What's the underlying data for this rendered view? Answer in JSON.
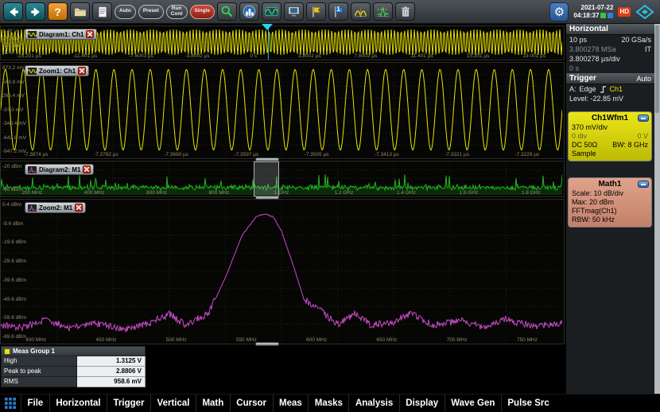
{
  "toolbar": {
    "help_glyph": "?",
    "auto_label": "Auto",
    "preset_label": "Preset",
    "run_label_1": "Run",
    "run_label_2": "Cont",
    "single_label": "Single",
    "marker_glyph": "1",
    "datetime": {
      "date": "2021-07-22",
      "time": "04:18:37"
    },
    "hd_badge": "HD"
  },
  "icons": {
    "gear": "⚙"
  },
  "chart_data": [
    {
      "id": "diagram1",
      "type": "line",
      "title": "Diagram1: Ch1",
      "signal": "sine",
      "cycles": 170,
      "amplitude_frac": 0.8,
      "color": "#e8e400",
      "ylim": [
        "-1.48 V",
        "1.48 V"
      ],
      "y_ticks": [
        "1.48 V",
        "740 mV",
        "-740 mV",
        "-1.48 V"
      ],
      "x_ticks": [
        "-15.201 µs",
        "-11.401 µs",
        "-7.6003 µs",
        "-3.8002 µs",
        "0 s",
        "3.8002 µs",
        "7.6003 µs",
        "11.401 µs",
        "15.201 µs",
        "19.001 µs"
      ]
    },
    {
      "id": "zoom1",
      "type": "line",
      "title": "Zoom1: Ch1",
      "signal": "sine",
      "cycles": 31,
      "amplitude_frac": 0.86,
      "color": "#e8e400",
      "y_ticks": [
        "873.2 mV",
        "569.8 mV",
        "266.4 mV",
        "-37.0 mV",
        "-340.4 mV",
        "-643.8 mV",
        "-947.2 mV"
      ],
      "x_ticks": [
        "-7.3874 µs",
        "-7.3782 µs",
        "-7.3690 µs",
        "-7.3597 µs",
        "-7.3505 µs",
        "-7.3413 µs",
        "-7.3321 µs",
        "-7.3229 µs"
      ]
    },
    {
      "id": "diagram2",
      "type": "line",
      "title": "Diagram2: M1",
      "signal": "spectrum-floor",
      "baseline_frac": 0.78,
      "color": "#1eb41e",
      "y_ticks": [
        "-20 dBm",
        "-80 dBm"
      ],
      "x_ticks": [
        "200 MHz",
        "400 MHz",
        "600 MHz",
        "800 MHz",
        "1 GHz",
        "1.2 GHz",
        "1.4 GHz",
        "1.6 GHz",
        "1.8 GHz"
      ]
    },
    {
      "id": "zoom2",
      "type": "line",
      "title": "Zoom2: M1",
      "signal": "spectrum-peak",
      "color": "#c44cc4",
      "control_points": [
        [
          0,
          0.88
        ],
        [
          0.04,
          0.9
        ],
        [
          0.08,
          0.84
        ],
        [
          0.12,
          0.9
        ],
        [
          0.17,
          0.87
        ],
        [
          0.22,
          0.91
        ],
        [
          0.27,
          0.86
        ],
        [
          0.3,
          0.8
        ],
        [
          0.33,
          0.88
        ],
        [
          0.37,
          0.8
        ],
        [
          0.4,
          0.55
        ],
        [
          0.43,
          0.25
        ],
        [
          0.455,
          0.12
        ],
        [
          0.47,
          0.1
        ],
        [
          0.485,
          0.12
        ],
        [
          0.5,
          0.22
        ],
        [
          0.52,
          0.45
        ],
        [
          0.54,
          0.7
        ],
        [
          0.57,
          0.78
        ],
        [
          0.6,
          0.88
        ],
        [
          0.63,
          0.8
        ],
        [
          0.66,
          0.88
        ],
        [
          0.7,
          0.86
        ],
        [
          0.73,
          0.8
        ],
        [
          0.77,
          0.88
        ],
        [
          0.82,
          0.85
        ],
        [
          0.86,
          0.9
        ],
        [
          0.9,
          0.84
        ],
        [
          0.95,
          0.89
        ],
        [
          1,
          0.87
        ]
      ],
      "y_ticks": [
        "0.4 dBm",
        "-9.6 dBm",
        "-19.6 dBm",
        "-29.6 dBm",
        "-39.6 dBm",
        "-49.6 dBm",
        "-59.6 dBm",
        "-69.6 dBm"
      ],
      "x_ticks": [
        "400 MHz",
        "450 MHz",
        "500 MHz",
        "550 MHz",
        "600 MHz",
        "650 MHz",
        "700 MHz",
        "750 MHz"
      ]
    }
  ],
  "meas": {
    "title": "Meas Group 1",
    "rows": [
      {
        "label": "High",
        "value": "1.3125 V"
      },
      {
        "label": "Peak to peak",
        "value": "2.8806 V"
      },
      {
        "label": "RMS",
        "value": "958.6 mV"
      }
    ]
  },
  "sidebar": {
    "horizontal": {
      "title": "Horizontal",
      "resolution": "10 ps",
      "sample_rate": "20 GSa/s",
      "record_length": "3.800278 MSa",
      "mode": "IT",
      "scale": "3.800278 µs/div",
      "position": "0 s"
    },
    "trigger": {
      "title": "Trigger",
      "state": "Auto",
      "source_label": "A:",
      "type": "Edge",
      "source": "Ch1",
      "level": "Level: -22.85 mV"
    },
    "ch1": {
      "title": "Ch1Wfm1",
      "scale": "370 mV/div",
      "offset_div": "0 div",
      "offset": "0 V",
      "coupling": "DC 50Ω",
      "bandwidth": "BW: 8 GHz",
      "decimation": "Sample"
    },
    "math1": {
      "title": "Math1",
      "scale": "Scale: 10 dB/div",
      "max": "Max:  20 dBm",
      "expression": "FFTmag(Ch1)",
      "rbw": "RBW: 50 kHz"
    }
  },
  "menu": {
    "items": [
      "File",
      "Horizontal",
      "Trigger",
      "Vertical",
      "Math",
      "Cursor",
      "Meas",
      "Masks",
      "Analysis",
      "Display",
      "Wave Gen",
      "Pulse Src"
    ]
  },
  "colors": {
    "ch1": "#e8e400",
    "math": "#c44cc4",
    "spectrum_floor": "#1eb41e",
    "accent_cyan": "#28d2eb",
    "single_red": "#c03828"
  }
}
